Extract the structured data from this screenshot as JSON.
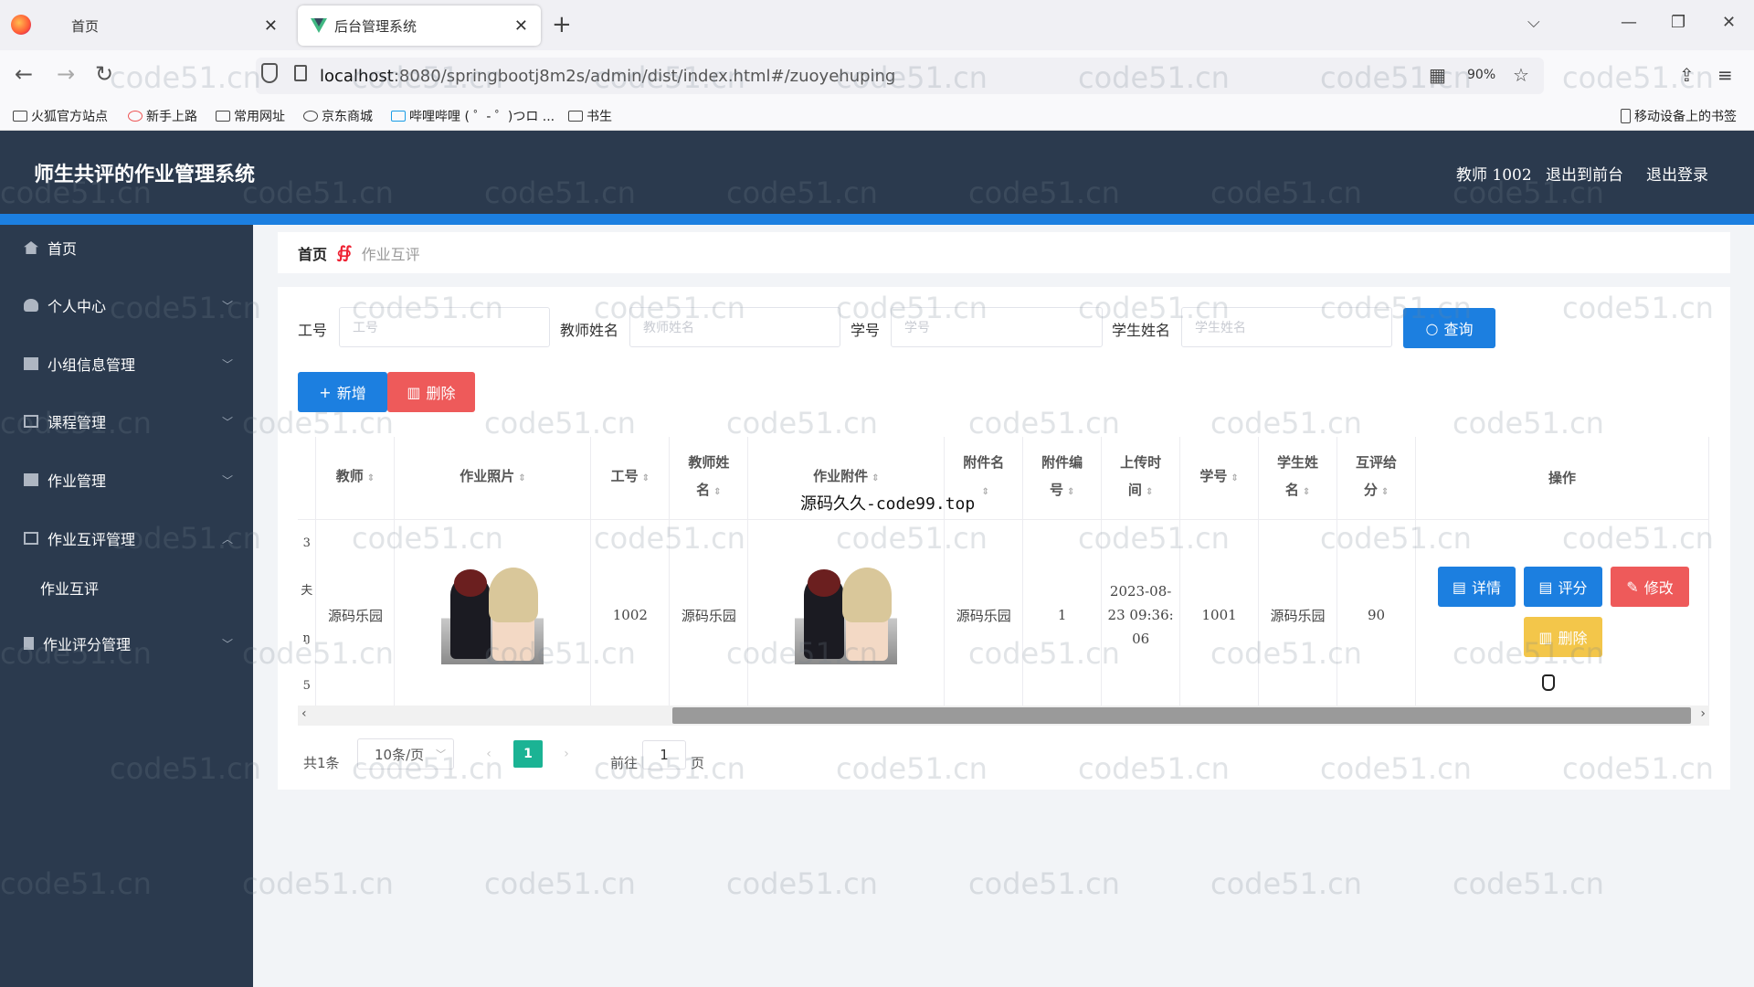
{
  "browser": {
    "tabs": [
      {
        "title": "首页",
        "active": false
      },
      {
        "title": "后台管理系统",
        "active": true
      }
    ],
    "url_host": "localhost",
    "url_rest": ":8080/springbootj8m2s/admin/dist/index.html#/zuoyehuping",
    "zoom": "90%",
    "bookmarks": [
      "火狐官方站点",
      "新手上路",
      "常用网址",
      "京东商城",
      "哔哩哔哩 ( ゜- ゜)つロ ...",
      "书生"
    ],
    "mobile_bookmarks": "移动设备上的书签"
  },
  "header": {
    "title": "师生共评的作业管理系统",
    "user": "教师 1002",
    "to_front": "退出到前台",
    "logout": "退出登录"
  },
  "sidebar": {
    "items": [
      {
        "label": "首页"
      },
      {
        "label": "个人中心"
      },
      {
        "label": "小组信息管理"
      },
      {
        "label": "课程管理"
      },
      {
        "label": "作业管理"
      },
      {
        "label": "作业互评管理"
      },
      {
        "label": "作业评分管理"
      }
    ],
    "sub_item": "作业互评"
  },
  "breadcrumb": {
    "home": "首页",
    "current": "作业互评"
  },
  "search": {
    "fields": [
      {
        "label": "工号",
        "placeholder": "工号"
      },
      {
        "label": "教师姓名",
        "placeholder": "教师姓名"
      },
      {
        "label": "学号",
        "placeholder": "学号"
      },
      {
        "label": "学生姓名",
        "placeholder": "学生姓名"
      }
    ],
    "query_button": "查询"
  },
  "actions": {
    "add": "新增",
    "delete": "删除"
  },
  "table": {
    "headers": {
      "teacher": "教师",
      "photo": "作业照片",
      "job_no": "工号",
      "teacher_name_1": "教师姓",
      "teacher_name_2": "名",
      "attachment": "作业附件",
      "att_name": "附件名",
      "att_no_1": "附件编",
      "att_no_2": "号",
      "upload_1": "上传时",
      "upload_2": "间",
      "student_no": "学号",
      "student_name_1": "学生姓",
      "student_name_2": "名",
      "score_1": "互评给",
      "score_2": "分",
      "ops": "操作"
    },
    "row": {
      "teacher": "源码乐园",
      "job_no": "1002",
      "teacher_name": "源码乐园",
      "att_name": "源码乐园",
      "att_no": "1",
      "upload_1": "2023-08-",
      "upload_2": "23 09:36:",
      "upload_3": "06",
      "student_no": "1001",
      "student_name": "源码乐园",
      "score": "90",
      "cut_1": "3",
      "cut_2": "夫",
      "cut_3": "ŋ",
      "cut_4": "5"
    },
    "row_buttons": {
      "detail": "详情",
      "rate": "评分",
      "edit": "修改",
      "delete": "删除"
    }
  },
  "overlay_text": "源码久久-code99.top",
  "pagination": {
    "total": "共1条",
    "page_size": "10条/页",
    "current": "1",
    "goto_prefix": "前往",
    "goto_value": "1",
    "goto_suffix": "页"
  },
  "watermark": "code51.cn"
}
